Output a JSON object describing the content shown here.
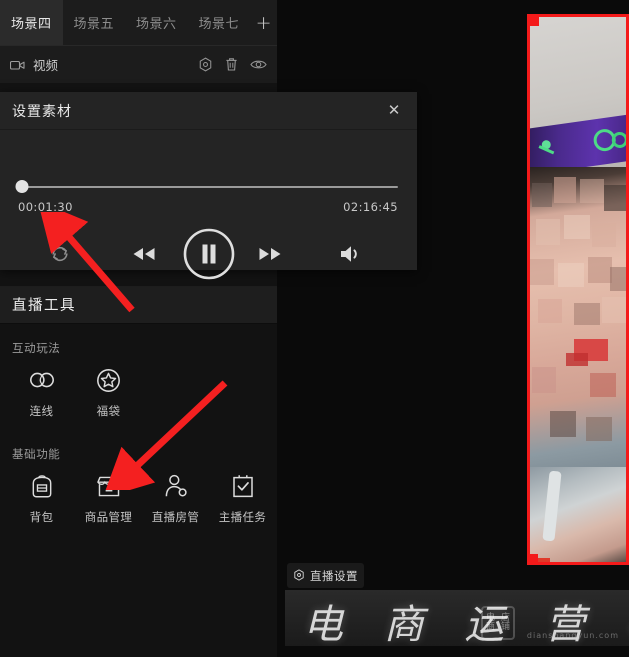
{
  "scene_tabs": [
    {
      "label": "场景四",
      "active": true
    },
    {
      "label": "场景五",
      "active": false
    },
    {
      "label": "场景六",
      "active": false
    },
    {
      "label": "场景七",
      "active": false
    }
  ],
  "scene_add_label": "+",
  "source_row": {
    "icon": "video-camera-icon",
    "label": "视频",
    "actions": [
      {
        "name": "settings-icon",
        "title": "设置"
      },
      {
        "name": "trash-icon",
        "title": "删除"
      },
      {
        "name": "eye-icon",
        "title": "显示"
      }
    ]
  },
  "settings_panel": {
    "title": "设置素材",
    "close_label": "✕",
    "progress_percent": 1.1,
    "current_time": "00:01:30",
    "total_time": "02:16:45",
    "controls": [
      {
        "name": "loop-button",
        "glyph": "loop"
      },
      {
        "name": "rewind-button",
        "glyph": "rewind"
      },
      {
        "name": "pause-button",
        "glyph": "pause"
      },
      {
        "name": "fast-forward-button",
        "glyph": "forward"
      },
      {
        "name": "volume-button",
        "glyph": "volume"
      }
    ]
  },
  "live_tools": {
    "title": "直播工具",
    "sections": [
      {
        "label": "互动玩法",
        "items": [
          {
            "icon": "link-rings-icon",
            "label": "连线"
          },
          {
            "icon": "star-circle-icon",
            "label": "福袋"
          }
        ]
      },
      {
        "label": "基础功能",
        "items": [
          {
            "icon": "backpack-icon",
            "label": "背包"
          },
          {
            "icon": "shop-icon",
            "label": "商品管理"
          },
          {
            "icon": "person-badge-icon",
            "label": "直播房管"
          },
          {
            "icon": "clipboard-check-icon",
            "label": "主播任务"
          }
        ]
      }
    ]
  },
  "preview": {
    "live_settings_label": "直播设置",
    "live_settings_icon": "gear-icon",
    "selection_color": "#f41a1a"
  },
  "watermark": {
    "text": "电 商 运 营 客",
    "badge_line1": "电商",
    "badge_line2": "店铺",
    "subtext": "dianshangyun.com"
  },
  "annotations": {
    "arrow_color": "#f42020",
    "arrow_1_target": "loop-button",
    "arrow_2_target": "商品管理"
  }
}
